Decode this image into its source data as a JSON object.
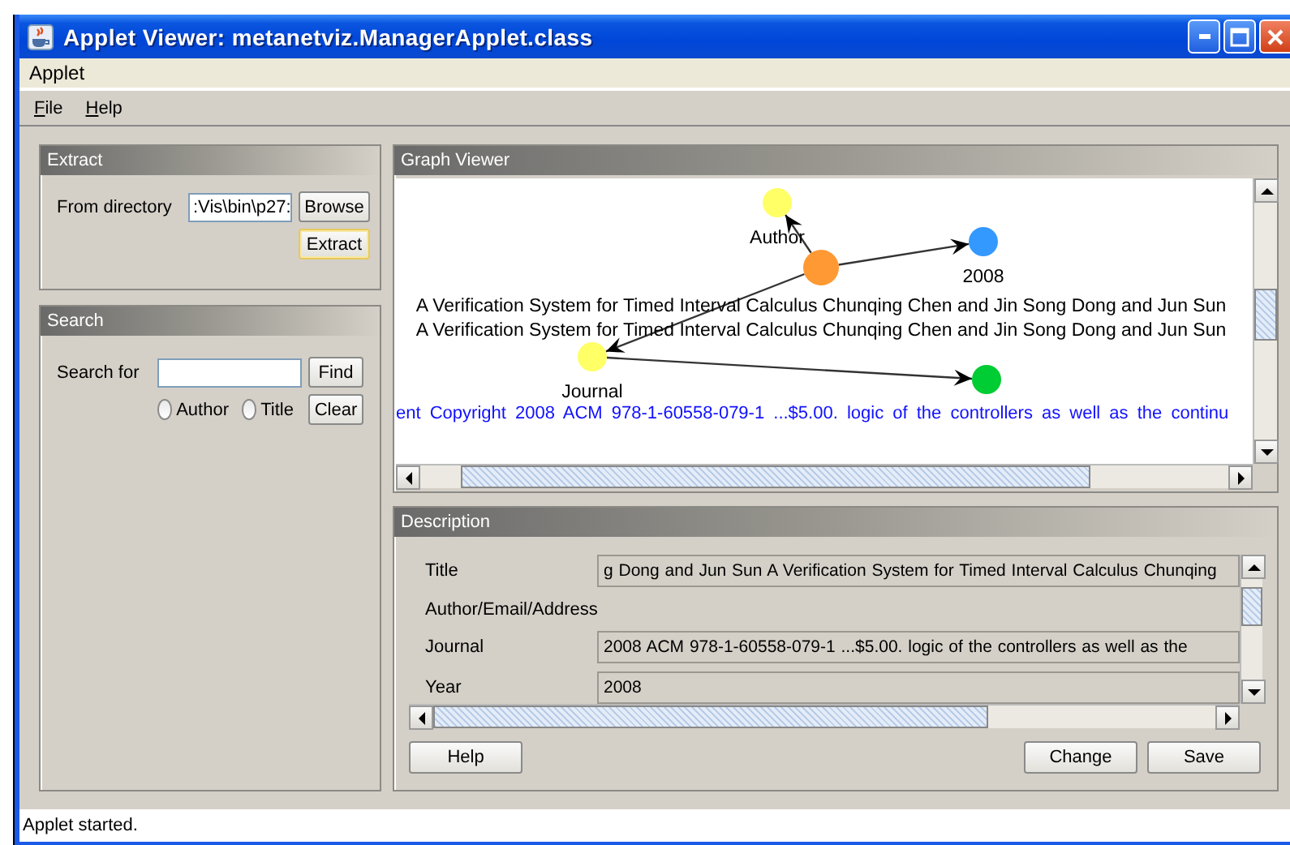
{
  "window": {
    "title": "Applet Viewer: metanetviz.ManagerApplet.class"
  },
  "applet_menu": [
    "Applet"
  ],
  "menubar": [
    "File",
    "Help"
  ],
  "extract": {
    "title": "Extract",
    "label": "From directory",
    "field_value": ":Vis\\bin\\p27:",
    "buttons": [
      {
        "label": "Browse",
        "focused": false
      },
      {
        "label": "Extract",
        "focused": true
      }
    ]
  },
  "search": {
    "title": "Search",
    "label": "Search for",
    "find_button": "Find",
    "clear_button": "Clear",
    "radios": [
      {
        "label": "Author",
        "selected": false
      },
      {
        "label": "Title",
        "selected": false
      }
    ]
  },
  "graph_viewer": {
    "title": "Graph Viewer",
    "nodes": [
      {
        "color": "#ffff66"
      },
      {
        "color": "#ff9933"
      },
      {
        "color": "#3399ff"
      },
      {
        "color": "#ffff66"
      },
      {
        "color": "#00cc33"
      }
    ],
    "texts": [
      {
        "kind": "attribute",
        "text": "Author"
      },
      {
        "kind": "attribute",
        "text": "2008"
      },
      {
        "kind": "title",
        "text": "A Verification System for Timed Interval Calculus Chunqing Chen and Jin Song Dong and Jun Sun"
      },
      {
        "kind": "title",
        "text": "A Verification System for Timed Interval Calculus Chunqing Chen and Jin Song Dong and Jun Sun"
      },
      {
        "kind": "attribute",
        "text": "Journal"
      },
      {
        "kind": "content",
        "text": "ent Copyright 2008 ACM 978-1-60558-079-1 ...$5.00. logic of the controllers as well as the continu"
      }
    ]
  },
  "description": {
    "title": "Description",
    "rows": [
      {
        "kind": "field",
        "label": "Title",
        "value": "g Dong and Jun Sun A Verification System for Timed Interval Calculus Chunqing"
      },
      {
        "kind": "label",
        "label": "Author/Email/Address"
      },
      {
        "kind": "field",
        "label": "Journal",
        "value": "2008 ACM 978-1-60558-079-1 ...$5.00. logic of the controllers as well as the"
      },
      {
        "kind": "field",
        "label": "Year",
        "value": "2008"
      }
    ],
    "left_buttons": [
      "Help"
    ],
    "right_buttons": [
      "Change",
      "Save"
    ]
  },
  "status_bar": "Applet started."
}
